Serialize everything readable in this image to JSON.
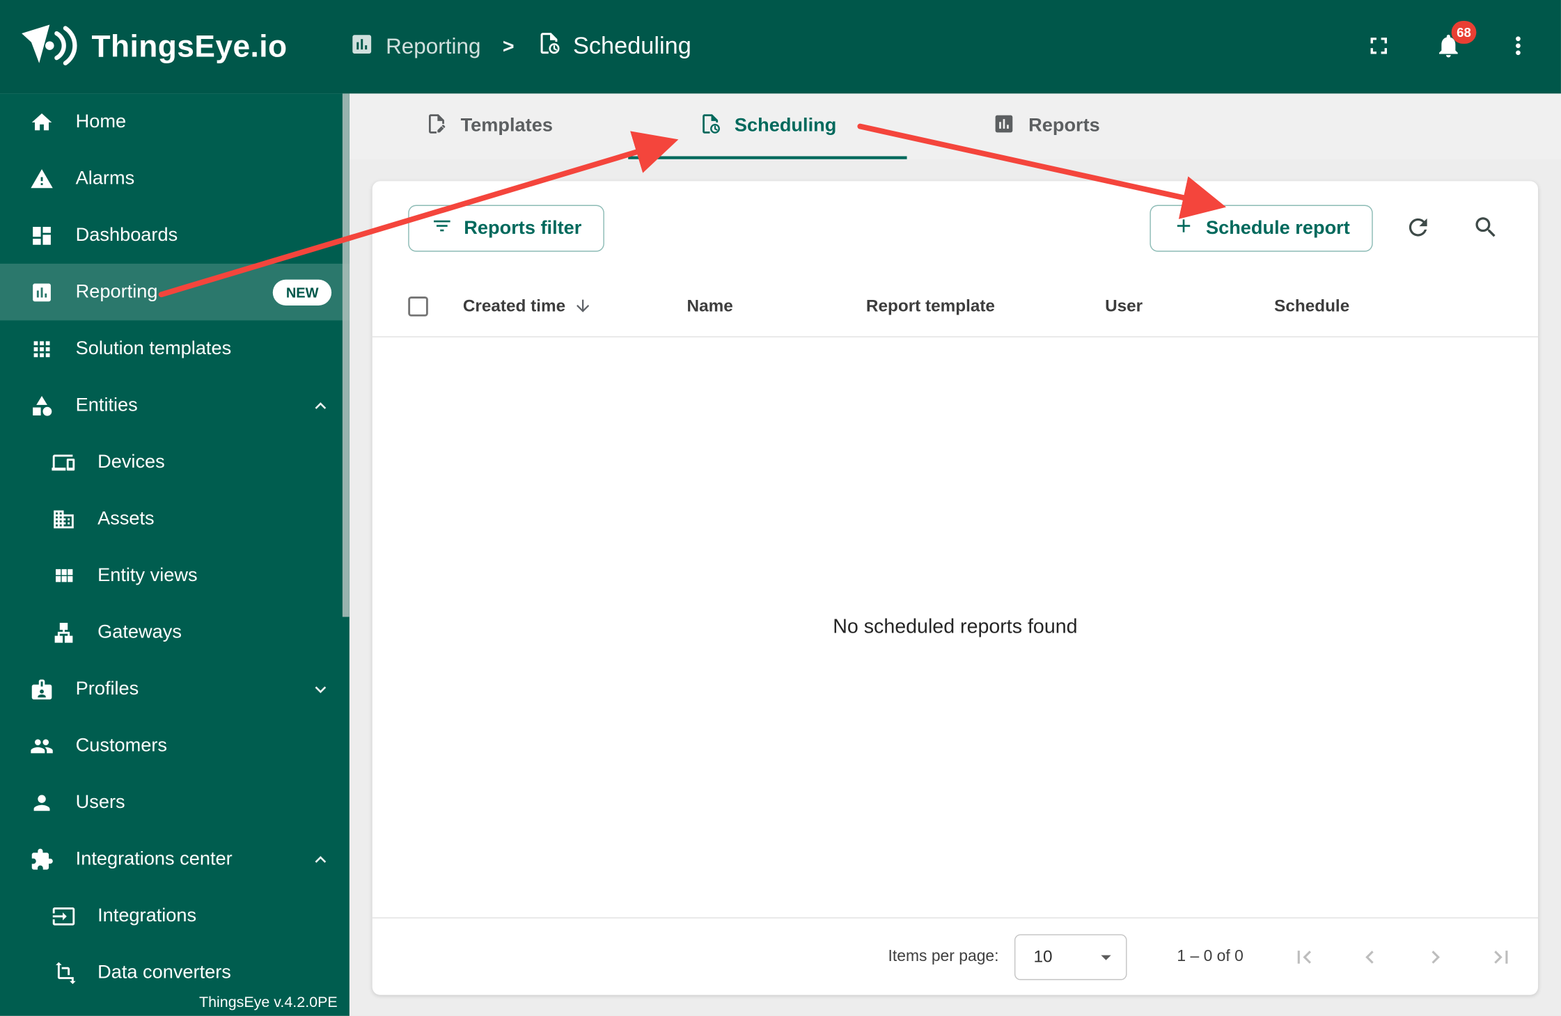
{
  "colors": {
    "header_bg": "#00574A",
    "sidebar_bg": "#005D4F",
    "accent": "#00695C",
    "annotation_arrow": "#F4453C",
    "notification_badge_bg": "#E93F33"
  },
  "header": {
    "brand": "ThingsEye.io",
    "breadcrumb": {
      "section": "Reporting",
      "separator": ">",
      "page": "Scheduling"
    },
    "notifications_count": "68"
  },
  "sidebar": {
    "items": [
      {
        "label": "Home",
        "icon": "home-icon"
      },
      {
        "label": "Alarms",
        "icon": "alarms-icon"
      },
      {
        "label": "Dashboards",
        "icon": "dashboards-icon"
      },
      {
        "label": "Reporting",
        "icon": "reporting-icon",
        "badge": "NEW",
        "active": true
      },
      {
        "label": "Solution templates",
        "icon": "solution-templates-icon"
      },
      {
        "label": "Entities",
        "icon": "entities-icon",
        "state": "expanded"
      },
      {
        "label": "Devices",
        "icon": "devices-icon"
      },
      {
        "label": "Assets",
        "icon": "assets-icon"
      },
      {
        "label": "Entity views",
        "icon": "entity-views-icon"
      },
      {
        "label": "Gateways",
        "icon": "gateways-icon"
      },
      {
        "label": "Profiles",
        "icon": "profiles-icon",
        "state": "collapsed"
      },
      {
        "label": "Customers",
        "icon": "customers-icon"
      },
      {
        "label": "Users",
        "icon": "users-icon"
      },
      {
        "label": "Integrations center",
        "icon": "integrations-center-icon",
        "state": "expanded"
      },
      {
        "label": "Integrations",
        "icon": "integrations-icon"
      },
      {
        "label": "Data converters",
        "icon": "data-converters-icon"
      }
    ],
    "version": "ThingsEye v.4.2.0PE"
  },
  "tabs": [
    {
      "label": "Templates",
      "icon": "templates-icon"
    },
    {
      "label": "Scheduling",
      "icon": "scheduling-icon",
      "active": true
    },
    {
      "label": "Reports",
      "icon": "reports-icon"
    }
  ],
  "toolbar": {
    "filter_button": "Reports filter",
    "schedule_button": "Schedule report"
  },
  "table": {
    "columns": {
      "created_time": "Created time",
      "name": "Name",
      "report_template": "Report template",
      "user": "User",
      "schedule": "Schedule"
    },
    "empty_message": "No scheduled reports found"
  },
  "pagination": {
    "items_per_page_label": "Items per page:",
    "items_per_page_value": "10",
    "range": "1 – 0 of 0"
  }
}
